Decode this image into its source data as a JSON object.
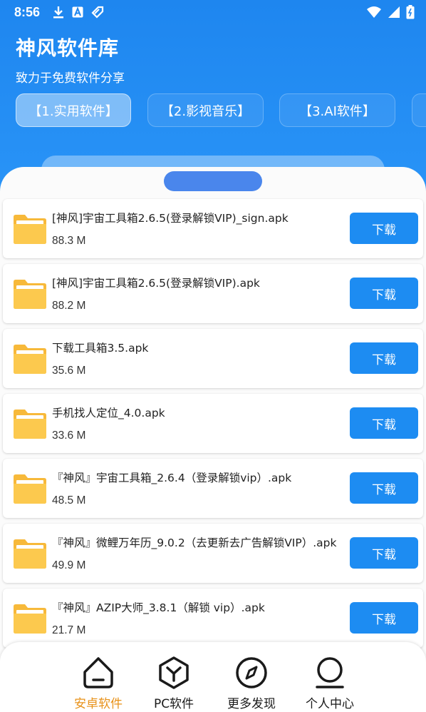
{
  "status_bar": {
    "time": "8:56",
    "left_icons": [
      "download-icon",
      "text-a-icon",
      "tag-icon"
    ],
    "right_icons": [
      "wifi-icon",
      "signal-icon",
      "battery-icon"
    ]
  },
  "header": {
    "title": "神风软件库",
    "subtitle": "致力于免费软件分享"
  },
  "tabs": [
    {
      "label": "【1.实用软件】",
      "active": true
    },
    {
      "label": "【2.影视音乐】",
      "active": false
    },
    {
      "label": "【3.AI软件】",
      "active": false
    },
    {
      "label": "",
      "active": false
    }
  ],
  "files": [
    {
      "name": "[神风]宇宙工具箱2.6.5(登录解锁VIP)_sign.apk",
      "size": "88.3 M",
      "button": "下载"
    },
    {
      "name": "[神风]宇宙工具箱2.6.5(登录解锁VIP).apk",
      "size": "88.2 M",
      "button": "下载"
    },
    {
      "name": "下载工具箱3.5.apk",
      "size": "35.6 M",
      "button": "下载"
    },
    {
      "name": "手机找人定位_4.0.apk",
      "size": "33.6 M",
      "button": "下载"
    },
    {
      "name": "『神风』宇宙工具箱_2.6.4（登录解锁vip）.apk",
      "size": "48.5 M",
      "button": "下载"
    },
    {
      "name": "『神风』微鲤万年历_9.0.2（去更新去广告解锁VIP）.apk",
      "size": "49.9 M",
      "button": "下载"
    },
    {
      "name": "『神风』AZIP大师_3.8.1（解锁 vip）.apk",
      "size": "21.7 M",
      "button": "下载"
    }
  ],
  "bottom_nav": [
    {
      "label": "安卓软件",
      "icon": "android-home-icon",
      "active": true
    },
    {
      "label": "PC软件",
      "icon": "hexagon-y-icon",
      "active": false
    },
    {
      "label": "更多发现",
      "icon": "compass-icon",
      "active": false
    },
    {
      "label": "个人中心",
      "icon": "user-icon",
      "active": false
    }
  ],
  "colors": {
    "header_bg": "#1e86ef",
    "accent_button": "#1d8cf2",
    "handle": "#4a86ec",
    "nav_active": "#e8921a",
    "folder": "#fcc94e"
  }
}
